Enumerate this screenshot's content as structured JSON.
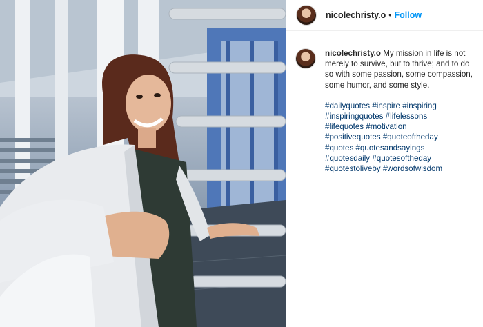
{
  "post": {
    "username": "nicolechristy.o",
    "separator": "•",
    "follow_label": "Follow"
  },
  "caption": {
    "username": "nicolechristy.o",
    "text": "My mission in life is not merely to survive, but to thrive; and to do so with some passion, some compassion, some humor, and some style.",
    "hashtags": [
      "#dailyquotes",
      "#inspire",
      "#inspiring",
      "#inspiringquotes",
      "#lifelessons",
      "#lifequotes",
      "#motivation",
      "#positivequotes",
      "#quoteoftheday",
      "#quotes",
      "#quotesandsayings",
      "#quotesdaily",
      "#quotesoftheday",
      "#quotestoliveby",
      "#wordsofwisdom"
    ]
  },
  "colors": {
    "link": "#00376b",
    "follow": "#0095f6",
    "text": "#262626"
  },
  "icons": [
    "avatar"
  ]
}
